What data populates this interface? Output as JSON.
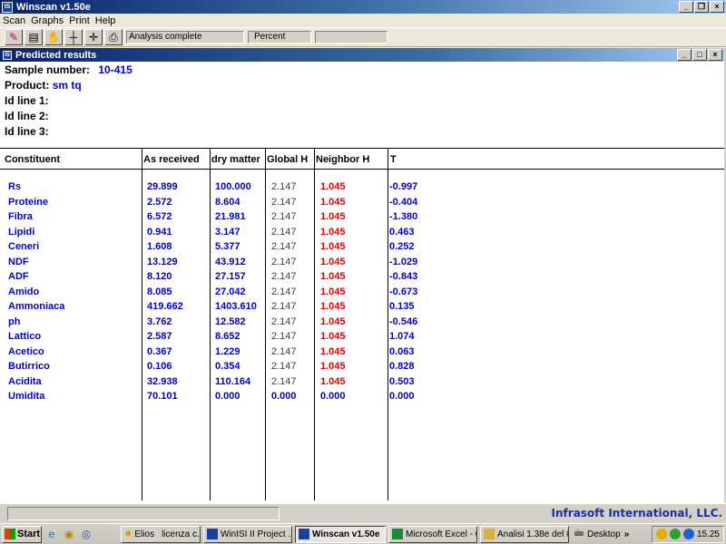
{
  "app": {
    "title": "Winscan v1.50e"
  },
  "menu": [
    "Scan",
    "Graphs",
    "Print",
    "Help"
  ],
  "toolbar": {
    "status": "Analysis complete",
    "percent_label": "Percent"
  },
  "child": {
    "title": "Predicted results",
    "sample_label": "Sample number:",
    "sample_value": "10-415",
    "product_label": "Product:",
    "product_value": "sm tq",
    "id1": "Id line 1:",
    "id2": "Id line 2:",
    "id3": "Id line 3:"
  },
  "table": {
    "headers": [
      "Constituent",
      "As received",
      "dry matter",
      "Global H",
      "Neighbor H",
      "T"
    ],
    "rows": [
      {
        "name": "Rs",
        "as_received": "29.899",
        "dry_matter": "100.000",
        "global_h": "2.147",
        "neighbor_h": "1.045",
        "t": "-0.997"
      },
      {
        "name": "Proteine",
        "as_received": "2.572",
        "dry_matter": "8.604",
        "global_h": "2.147",
        "neighbor_h": "1.045",
        "t": "-0.404"
      },
      {
        "name": "Fibra",
        "as_received": "6.572",
        "dry_matter": "21.981",
        "global_h": "2.147",
        "neighbor_h": "1.045",
        "t": "-1.380"
      },
      {
        "name": "Lipidi",
        "as_received": "0.941",
        "dry_matter": "3.147",
        "global_h": "2.147",
        "neighbor_h": "1.045",
        "t": "0.463"
      },
      {
        "name": "Ceneri",
        "as_received": "1.608",
        "dry_matter": "5.377",
        "global_h": "2.147",
        "neighbor_h": "1.045",
        "t": "0.252"
      },
      {
        "name": "NDF",
        "as_received": "13.129",
        "dry_matter": "43.912",
        "global_h": "2.147",
        "neighbor_h": "1.045",
        "t": "-1.029"
      },
      {
        "name": "ADF",
        "as_received": "8.120",
        "dry_matter": "27.157",
        "global_h": "2.147",
        "neighbor_h": "1.045",
        "t": "-0.843"
      },
      {
        "name": "Amido",
        "as_received": "8.085",
        "dry_matter": "27.042",
        "global_h": "2.147",
        "neighbor_h": "1.045",
        "t": "-0.673"
      },
      {
        "name": "Ammoniaca",
        "as_received": "419.662",
        "dry_matter": "1403.610",
        "global_h": "2.147",
        "neighbor_h": "1.045",
        "t": "0.135"
      },
      {
        "name": "ph",
        "as_received": "3.762",
        "dry_matter": "12.582",
        "global_h": "2.147",
        "neighbor_h": "1.045",
        "t": "-0.546"
      },
      {
        "name": "Lattico",
        "as_received": "2.587",
        "dry_matter": "8.652",
        "global_h": "2.147",
        "neighbor_h": "1.045",
        "t": "1.074"
      },
      {
        "name": "Acetico",
        "as_received": "0.367",
        "dry_matter": "1.229",
        "global_h": "2.147",
        "neighbor_h": "1.045",
        "t": "0.063"
      },
      {
        "name": "Butirrico",
        "as_received": "0.106",
        "dry_matter": "0.354",
        "global_h": "2.147",
        "neighbor_h": "1.045",
        "t": "0.828"
      },
      {
        "name": "Acidita",
        "as_received": "32.938",
        "dry_matter": "110.164",
        "global_h": "2.147",
        "neighbor_h": "1.045",
        "t": "0.503"
      },
      {
        "name": "Umidita",
        "as_received": "70.101",
        "dry_matter": "0.000",
        "global_h": "0.000",
        "neighbor_h": "0.000",
        "t": "0.000"
      }
    ]
  },
  "status": {
    "company": "Infrasoft International, LLC."
  },
  "taskbar": {
    "start": "Start",
    "tasks": [
      "Elios",
      "licenza c...",
      "WinISI II Project ...",
      "Winscan v1.50e",
      "Microsoft Excel - C...",
      "Analisi 1.38e del 0..."
    ],
    "desktop": "Desktop",
    "clock": "15.25"
  },
  "colors": {
    "value_blue": "#0000cc",
    "neighbor_red": "#e00000",
    "titlebar": "#0a246a"
  }
}
